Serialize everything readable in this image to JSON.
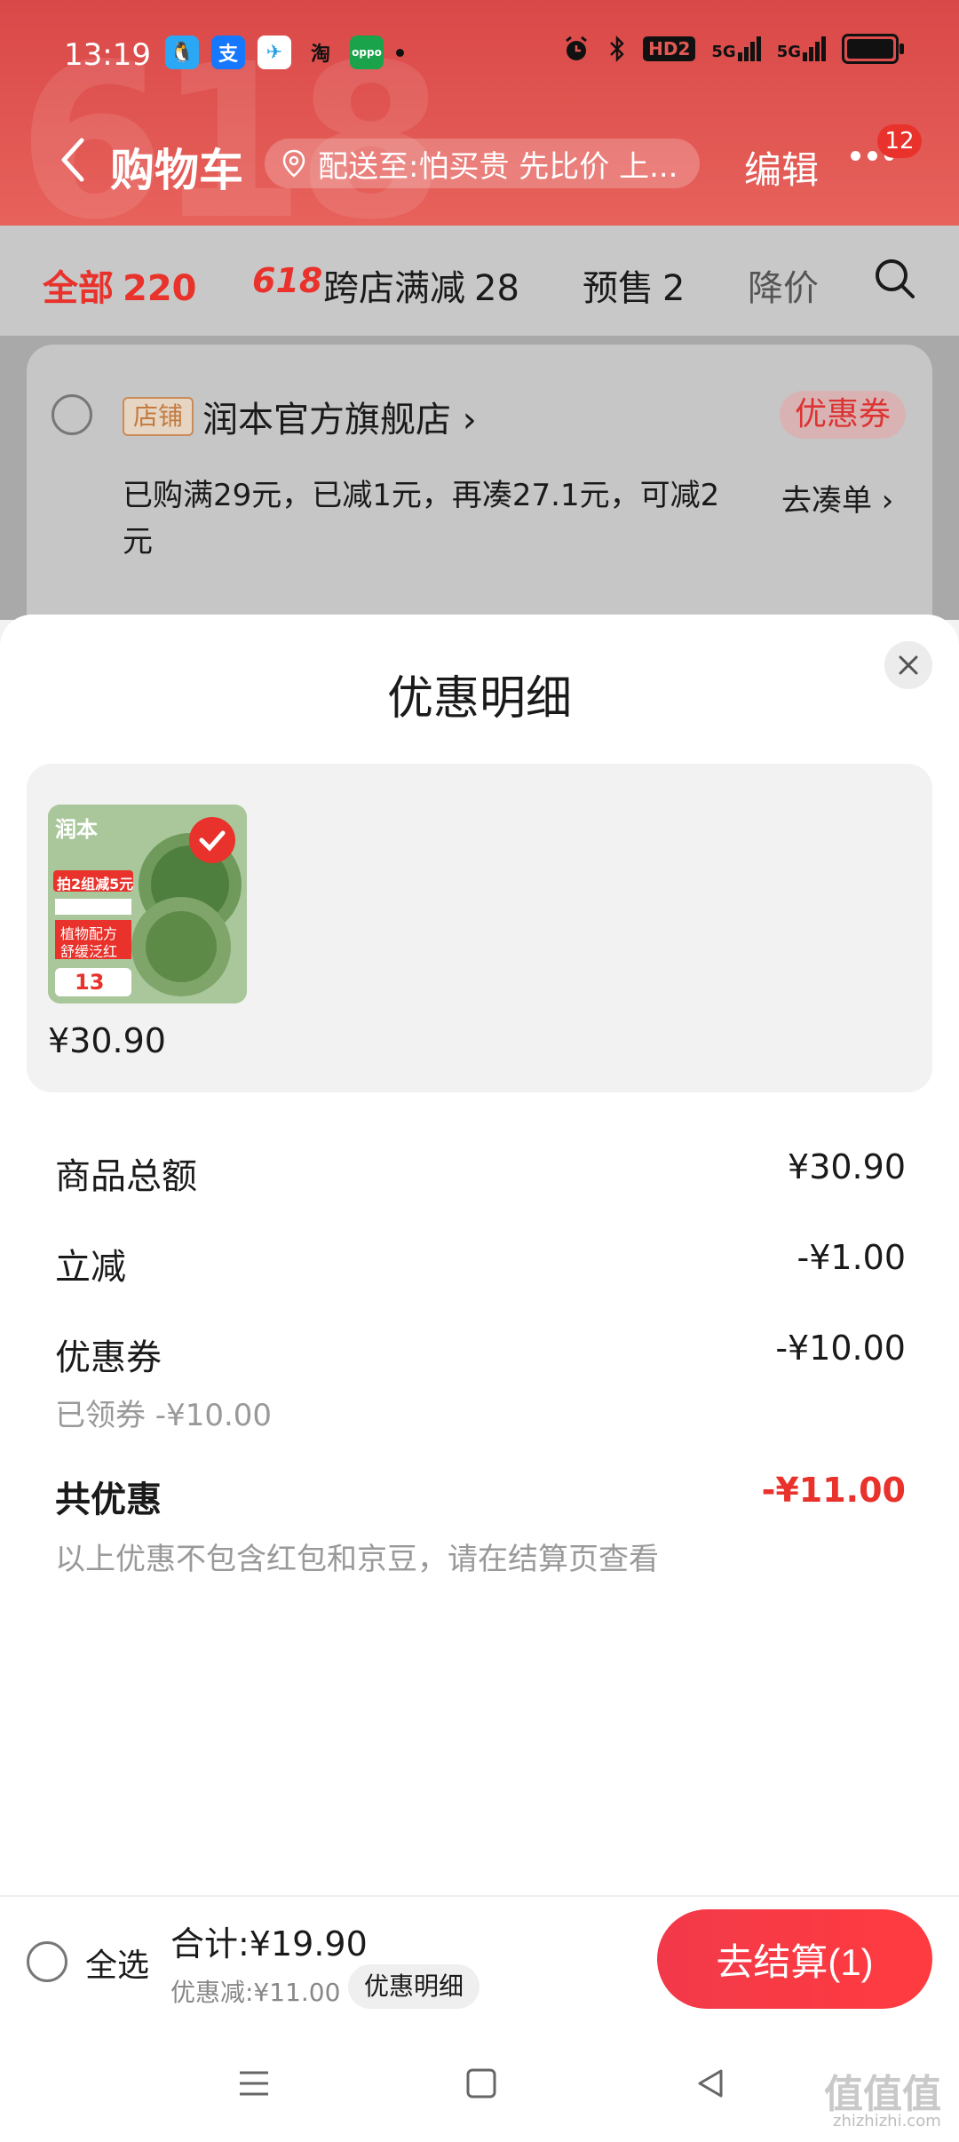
{
  "status_bar": {
    "time": "13:19",
    "apps": [
      {
        "name": "qq",
        "glyph": "🐧",
        "bg": "#2aa7f5"
      },
      {
        "name": "alipay",
        "glyph": "支",
        "bg": "#1677ff"
      },
      {
        "name": "telegram",
        "glyph": "✈",
        "bg": "#ffffff"
      },
      {
        "name": "taobao",
        "glyph": "淘",
        "bg": "transparent"
      },
      {
        "name": "oppo",
        "glyph": "oppo",
        "bg": "#1aa34a"
      }
    ],
    "network_label": "HD2",
    "signal1": "5G",
    "signal2": "5G"
  },
  "header": {
    "title": "购物车",
    "address": "配送至:怕买贵 先比价 上...",
    "edit_label": "编辑",
    "more_badge": "12"
  },
  "tabs": [
    {
      "label": "全部",
      "count": "220"
    },
    {
      "prefix": "618",
      "label": "跨店满减",
      "count": "28"
    },
    {
      "label": "预售",
      "count": "2"
    },
    {
      "label": "降价"
    }
  ],
  "store": {
    "tag": "店铺",
    "name": "润本官方旗舰店 ›",
    "coupon_label": "优惠券",
    "promo": "已购满29元，已减1元，再凑27.1元，可减2元",
    "collect_link": "去凑单 ›"
  },
  "sheet": {
    "title": "优惠明细",
    "product": {
      "price": "¥30.90",
      "thumb_brand": "润本",
      "thumb_promo": "拍2组减5元",
      "thumb_lines": [
        "植物配方",
        "舒缓泛红"
      ],
      "thumb_price": "13"
    },
    "rows": {
      "goods_total_label": "商品总额",
      "goods_total_value": "¥30.90",
      "instant_label": "立减",
      "instant_value": "-¥1.00",
      "coupon_label": "优惠券",
      "coupon_value": "-¥10.00",
      "coupon_sub": "已领券 -¥10.00",
      "total_label": "共优惠",
      "total_value": "-¥11.00",
      "note": "以上优惠不包含红包和京豆，请在结算页查看"
    }
  },
  "action_bar": {
    "select_all": "全选",
    "total": "合计:¥19.90",
    "discount": "优惠减:¥11.00",
    "detail_chip": "优惠明细",
    "checkout": "去结算(1)"
  },
  "watermark": {
    "text": "值值值",
    "url": "zhizhizhi.com"
  },
  "colors": {
    "brand_red": "#e8322b",
    "header_red": "#d94848",
    "checkout_red": "#f2394a"
  }
}
